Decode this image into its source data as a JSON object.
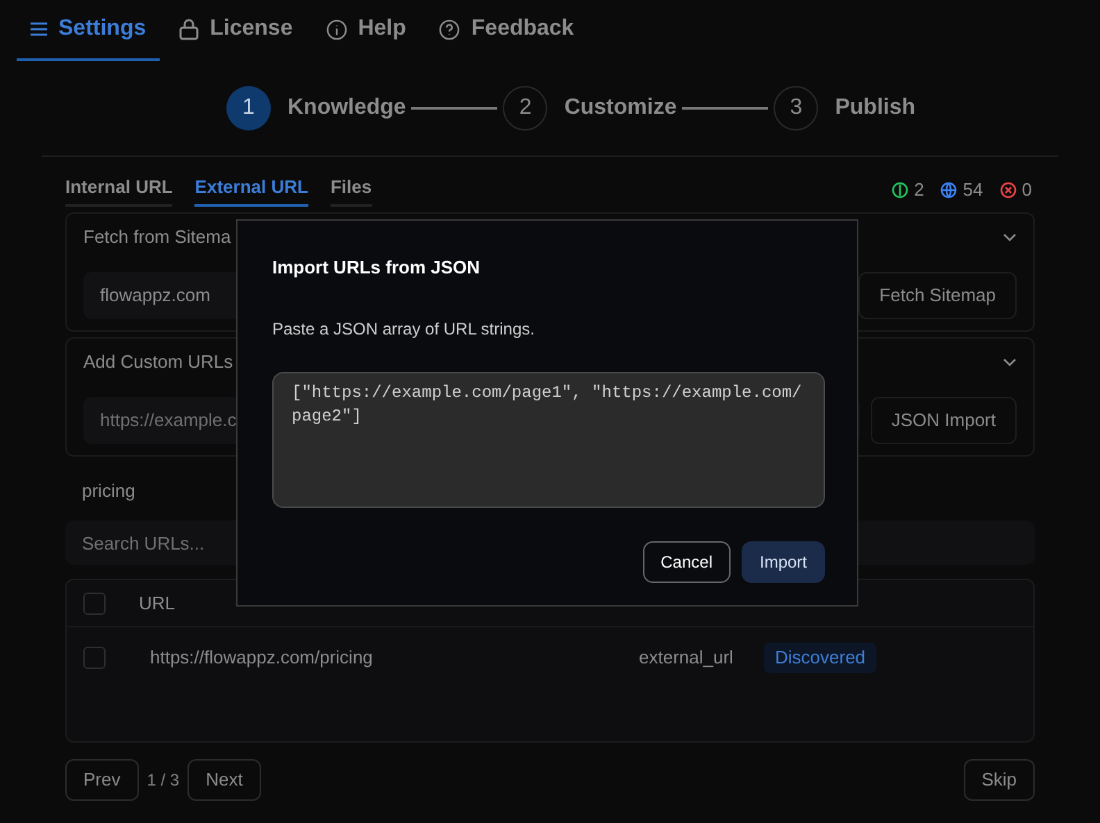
{
  "nav_tabs": [
    {
      "label": "Settings",
      "selected": true
    },
    {
      "label": "License",
      "selected": false
    },
    {
      "label": "Help",
      "selected": false
    },
    {
      "label": "Feedback",
      "selected": false
    }
  ],
  "stepper": [
    {
      "number": "1",
      "label": "Knowledge",
      "selected": true
    },
    {
      "number": "2",
      "label": "Customize",
      "selected": false
    },
    {
      "number": "3",
      "label": "Publish",
      "selected": false
    }
  ],
  "source_tabs": [
    {
      "label": "Internal URL",
      "selected": false
    },
    {
      "label": "External URL",
      "selected": true
    },
    {
      "label": "Files",
      "selected": false
    }
  ],
  "stats": [
    {
      "value": "2",
      "color": "#22c55e"
    },
    {
      "value": "54",
      "color": "#3b82f6"
    },
    {
      "value": "0",
      "color": "#ef4444"
    }
  ],
  "sitemap_section": {
    "title": "Fetch from Sitema",
    "value": "flowappz.com",
    "button": "Fetch Sitemap"
  },
  "custom_urls_section": {
    "title": "Add Custom URLs",
    "placeholder": "https://example.c",
    "button": "JSON Import"
  },
  "keyword_field": {
    "value": "pricing"
  },
  "search": {
    "placeholder": "Search URLs..."
  },
  "table": {
    "columns": [
      "URL"
    ],
    "header_checked": false,
    "rows": [
      {
        "url": "https://flowappz.com/pricing",
        "source": "external_url",
        "status": "Discovered",
        "checked": false
      }
    ]
  },
  "pagination": {
    "prev": "Prev",
    "page": "1 / 3",
    "next": "Next",
    "skip": "Skip"
  },
  "dialog": {
    "title": "Import URLs from JSON",
    "description": "Paste a JSON array of URL strings.",
    "value": "[\"https://example.com/page1\", \"https://example.com/page2\"]",
    "buttons": [
      {
        "label": "Cancel",
        "kind": "secondary"
      },
      {
        "label": "Import",
        "kind": "primary"
      }
    ]
  }
}
